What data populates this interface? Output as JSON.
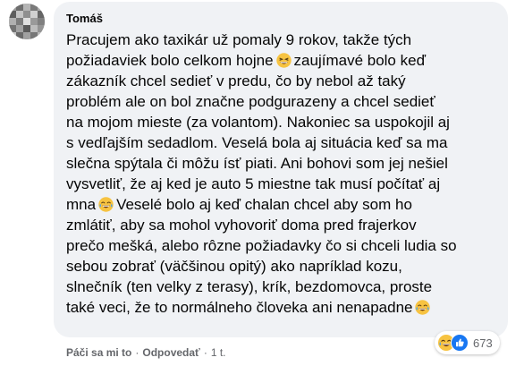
{
  "comment": {
    "author": "Tomáš",
    "lines": [
      "Pracujem ako taxikár už pomaly 9 rokov, takže tých",
      "požiadaviek bolo celkom hojne",
      "zaujímavé bolo keď",
      "zákazník chcel sedieť v predu, čo by nebol až taký",
      "problém ale on bol značne podgurazeny a chcel sedieť",
      "na mojom mieste (za volantom). Nakoniec sa uspokojil aj",
      "s vedľajším sedadlom. Veselá bola aj situácia keď sa ma",
      "slečna spýtala či môžu ísť piati. Ani bohovi som jej nešiel",
      "vysvetliť, že aj ked je auto 5 miestne tak musí počítať aj",
      "mna",
      "Veselé bolo aj keď chalan chcel aby som ho",
      "zmlátiť, aby sa mohol vyhovoriť doma pred frajerkov",
      "prečo mešká, alebo rôzne požiadavky čo si chceli ludia so",
      "sebou zobrať (väčšinou opitý) ako napríklad kozu,",
      "slnečník (ten velky z terasy), krík, bezdomovca, proste",
      "také veci, že to normálneho človeka ani nenapadne"
    ],
    "emojis": {
      "grin": "grinning-squinting-face-icon",
      "laugh": "face-with-tears-of-joy-icon"
    },
    "reactions": {
      "icons": [
        "haha-reaction-icon",
        "like-reaction-icon"
      ],
      "count": "673"
    },
    "actions": {
      "like": "Páči sa mi to",
      "separator": "·",
      "reply": "Odpovedať",
      "time": "1 t."
    }
  },
  "colors": {
    "bubble": "#f0f2f5",
    "text": "#050505",
    "secondary": "#65676b",
    "like_blue": "#1877f2",
    "emoji_yellow": "#f7c341"
  }
}
